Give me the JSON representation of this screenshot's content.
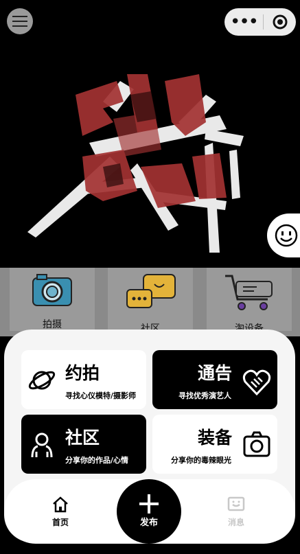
{
  "topbar": {
    "menu_icon": "hamburger-icon",
    "capsule": {
      "more_icon": "more-dots-icon",
      "close_icon": "target-icon"
    }
  },
  "hero": {
    "artwork": "graffiti-calligraphy-logo",
    "chat_icon": "smiley-face-icon"
  },
  "categories": [
    {
      "label": "拍摄",
      "icon": "camera-icon"
    },
    {
      "label": "社区",
      "icon": "chat-bubbles-icon"
    },
    {
      "label": "淘设备",
      "icon": "shopping-cart-icon"
    }
  ],
  "cards": {
    "yuepai": {
      "title": "约拍",
      "subtitle": "寻找心仪模特/摄影师",
      "icon": "planet-icon"
    },
    "tonggao": {
      "title": "通告",
      "subtitle": "寻找优秀演艺人",
      "icon": "handshake-heart-icon"
    },
    "shequ": {
      "title": "社区",
      "subtitle": "分享你的作品/心情",
      "icon": "people-icon"
    },
    "zhuangbei": {
      "title": "装备",
      "subtitle": "分享你的毒辣眼光",
      "icon": "camera-outline-icon"
    }
  },
  "tabs": {
    "home": {
      "label": "首页",
      "icon": "home-icon"
    },
    "publish": {
      "label": "发布",
      "icon": "plus-icon"
    },
    "messages": {
      "label": "消息",
      "icon": "message-icon"
    }
  },
  "colors": {
    "accent": "#000000",
    "disabled": "#c8c8c8",
    "sheet": "#f5f5f5"
  }
}
